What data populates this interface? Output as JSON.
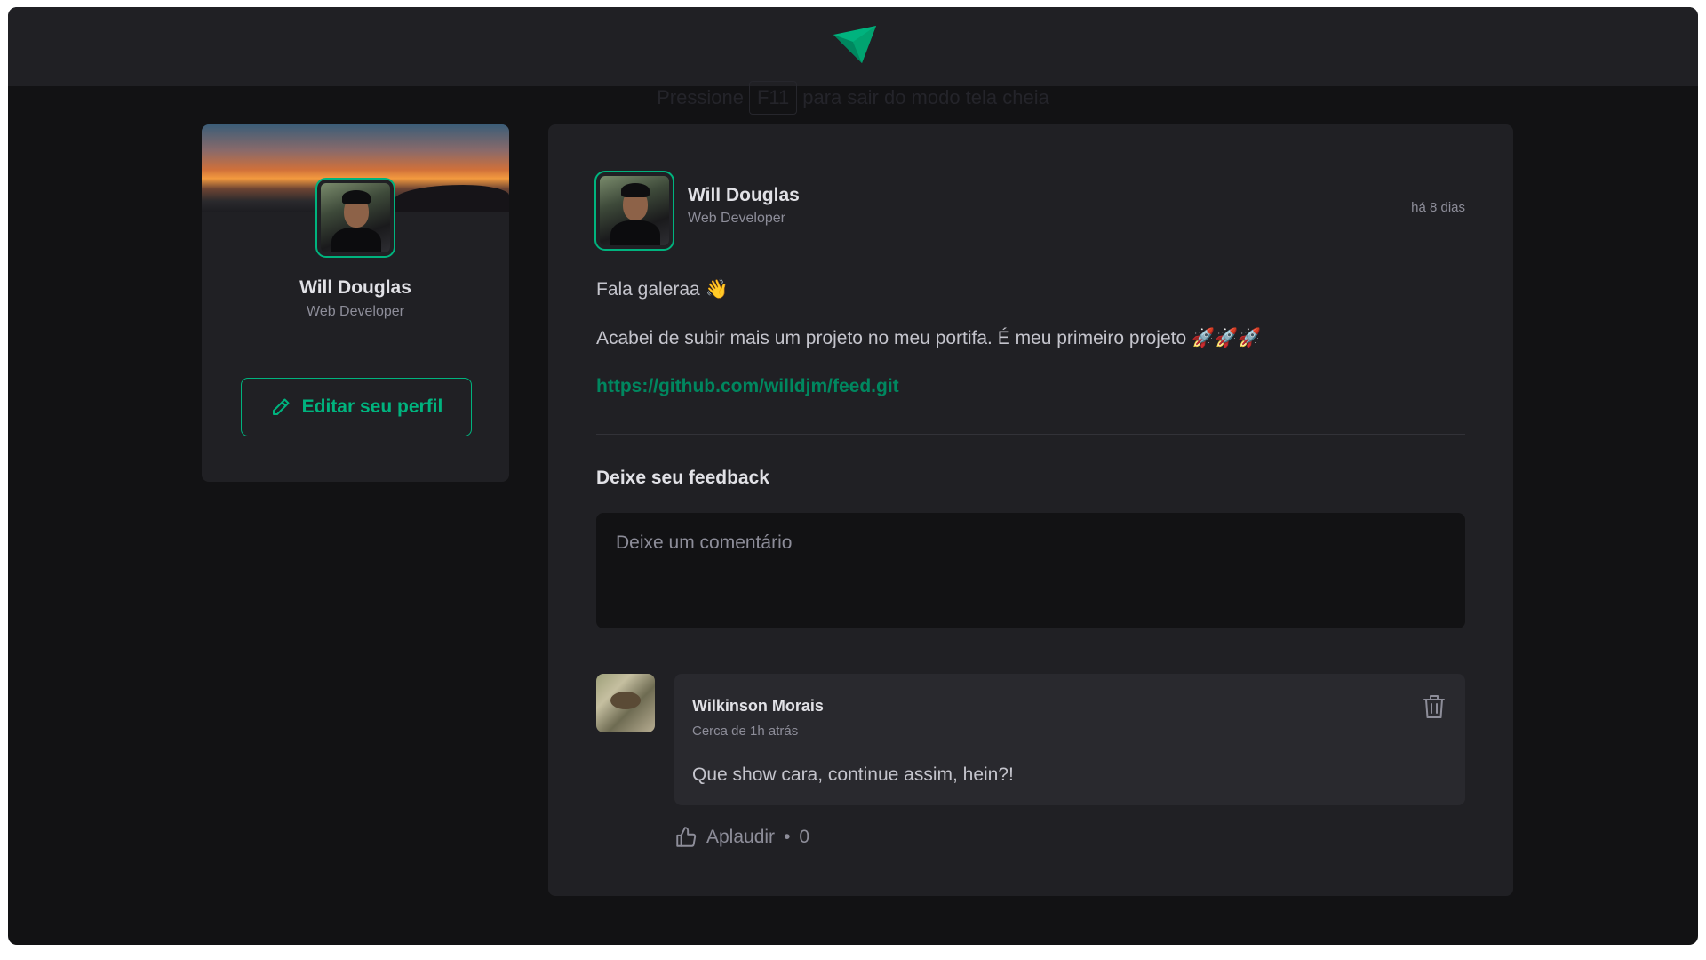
{
  "header": {
    "logo": "paper-plane-logo-icon"
  },
  "fullscreen_hint": {
    "before": "Pressione",
    "key": "F11",
    "after": "para sair do modo tela cheia"
  },
  "sidebar": {
    "name": "Will Douglas",
    "role": "Web Developer",
    "edit_button_label": "Editar seu perfil",
    "edit_icon": "pencil-icon"
  },
  "post": {
    "author": {
      "name": "Will Douglas",
      "role": "Web Developer"
    },
    "published_at": "há 8 dias",
    "content": {
      "greeting": "Fala galeraa 👋",
      "paragraph": "Acabei de subir mais um projeto no meu portifa. É meu primeiro projeto 🚀🚀🚀",
      "link": "https://github.com/willdjm/feed.git"
    },
    "feedback": {
      "title": "Deixe seu feedback",
      "placeholder": "Deixe um comentário"
    },
    "comments": [
      {
        "author": "Wilkinson Morais",
        "time": "Cerca de 1h atrás",
        "text": "Que show cara, continue assim, hein?!",
        "applaud_label": "Aplaudir",
        "applaud_separator": "•",
        "applaud_count": "0"
      }
    ]
  },
  "colors": {
    "accent": "#00b37e",
    "link": "#00875f",
    "background": "#121214",
    "card": "#202024"
  }
}
